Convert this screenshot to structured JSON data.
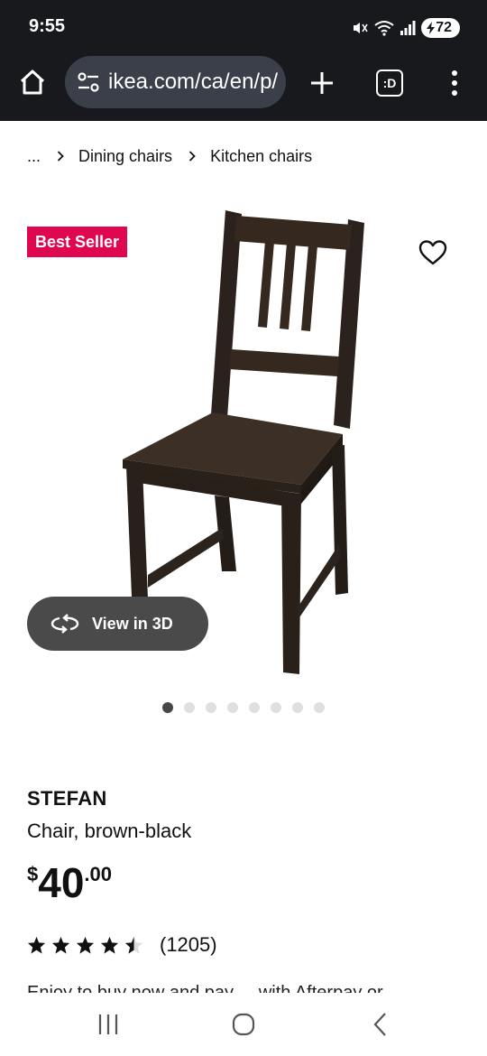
{
  "status_bar": {
    "time": "9:55",
    "battery": "72"
  },
  "browser": {
    "url": "ikea.com/ca/en/p/",
    "tabs_label": ":D",
    "icons": [
      "home-icon",
      "site-settings-icon",
      "plus-icon",
      "tab-switcher-icon",
      "more-vert-icon"
    ]
  },
  "breadcrumb": {
    "items": [
      "...",
      "Dining chairs",
      "Kitchen chairs"
    ]
  },
  "product_media": {
    "badge": "Best Seller",
    "view_3d_label": "View in 3D",
    "carousel": {
      "total": 8,
      "active_index": 0
    },
    "badge_color": "#e00751"
  },
  "product": {
    "name": "STEFAN",
    "description": "Chair, brown-black",
    "price": {
      "currency": "$",
      "integer": "40",
      "decimal": ".00"
    },
    "rating": {
      "stars": 4.5,
      "max": 5,
      "count": "(1205)"
    },
    "truncated_text": "Enjoy to buy now and pay ... with Afterpay or ..."
  },
  "nav_bar": {
    "icons": [
      "recent-apps-icon",
      "home-circle-icon",
      "back-icon"
    ]
  }
}
